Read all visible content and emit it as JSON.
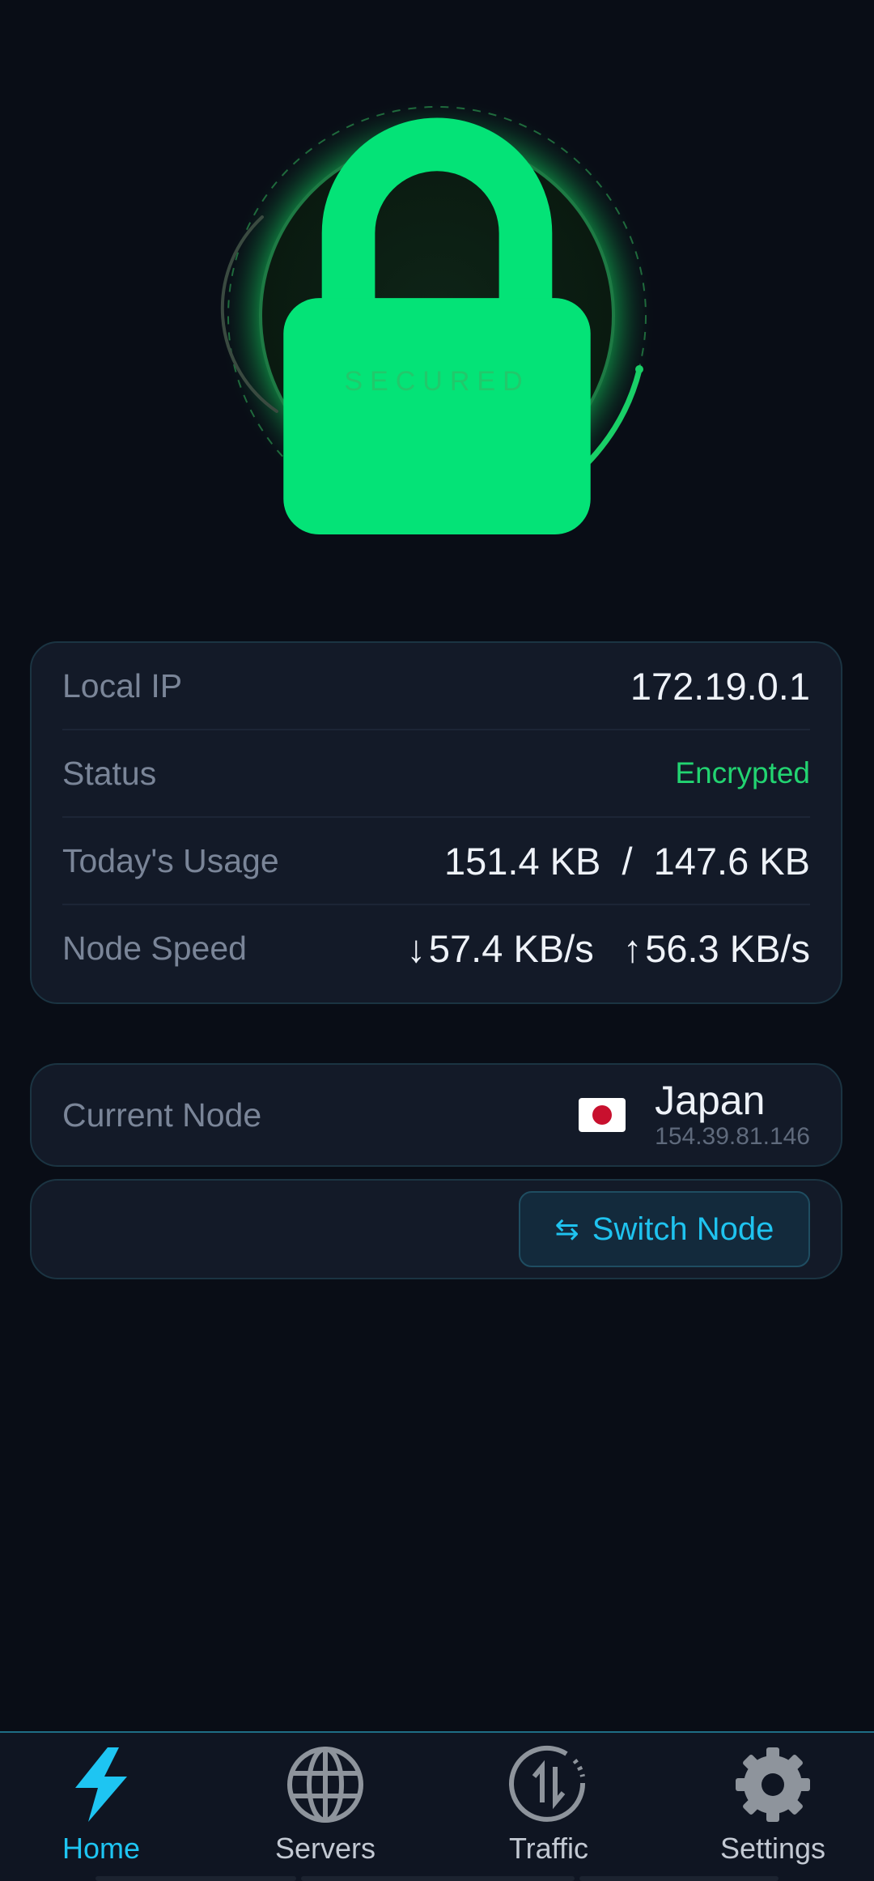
{
  "status": {
    "label": "SECURED",
    "accent": "#22d471"
  },
  "info": {
    "local_ip_label": "Local IP",
    "local_ip": "172.19.0.1",
    "status_label": "Status",
    "status_value": "Encrypted",
    "usage_label": "Today's Usage",
    "usage_value": "151.4 KB  /  147.6 KB",
    "speed_label": "Node Speed",
    "speed_down": "57.4 KB/s",
    "speed_up": "56.3 KB/s"
  },
  "node": {
    "label": "Current Node",
    "country": "Japan",
    "ip": "154.39.81.146",
    "flag": "japan-flag-icon"
  },
  "switch": {
    "label": "Switch Node",
    "icon": "swap-arrows-icon"
  },
  "nav": {
    "items": [
      {
        "label": "Home",
        "icon": "lightning-icon",
        "active": true
      },
      {
        "label": "Servers",
        "icon": "globe-icon",
        "active": false
      },
      {
        "label": "Traffic",
        "icon": "traffic-icon",
        "active": false
      },
      {
        "label": "Settings",
        "icon": "gear-icon",
        "active": false
      }
    ],
    "active_color": "#1ec5f2"
  }
}
